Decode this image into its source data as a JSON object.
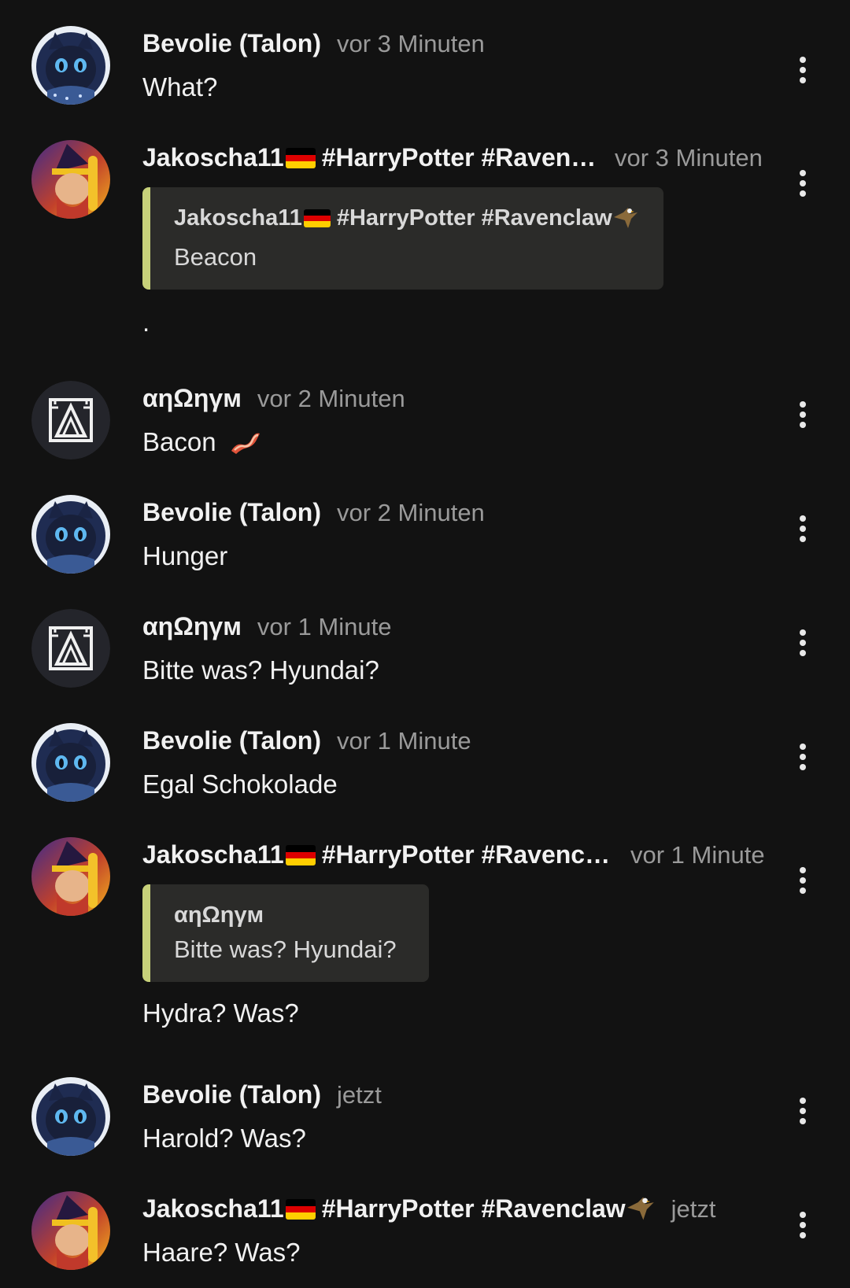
{
  "colors": {
    "background": "#121212",
    "time_text": "#9a9a9a",
    "quote_bar": "#c7d17a",
    "quote_bg": "#2b2b29"
  },
  "messages": [
    {
      "author": "Bevolie (Talon)",
      "time": "vor 3 Minuten",
      "text": "What?",
      "avatar": "blue-cat-avatar"
    },
    {
      "author_name": "Jakoscha11",
      "author_tags": "#HarryPotter #Ravencl…",
      "time": "vor 3 Minuten",
      "quote": {
        "author_name": "Jakoscha11",
        "author_tags": "#HarryPotter #Ravenclaw",
        "text": "Beacon"
      },
      "text": ".",
      "avatar": "wizard-avatar"
    },
    {
      "author": "αηΩηγм",
      "time": "vor 2 Minuten",
      "text": "Bacon",
      "emoji": "bacon-emoji",
      "avatar": "maze-logo-avatar"
    },
    {
      "author": "Bevolie (Talon)",
      "time": "vor 2 Minuten",
      "text": "Hunger",
      "avatar": "blue-cat-avatar"
    },
    {
      "author": "αηΩηγм",
      "time": "vor 1 Minute",
      "text": "Bitte was? Hyundai?",
      "avatar": "maze-logo-avatar"
    },
    {
      "author": "Bevolie (Talon)",
      "time": "vor 1 Minute",
      "text": "Egal Schokolade",
      "avatar": "blue-cat-avatar"
    },
    {
      "author_name": "Jakoscha11",
      "author_tags": "#HarryPotter #Ravencla…",
      "time": "vor 1 Minute",
      "quote": {
        "author": "αηΩηγм",
        "text": "Bitte was? Hyundai?"
      },
      "text": "Hydra? Was?",
      "avatar": "wizard-avatar"
    },
    {
      "author": "Bevolie (Talon)",
      "time": "jetzt",
      "text": "Harold? Was?",
      "avatar": "blue-cat-avatar"
    },
    {
      "author_name": "Jakoscha11",
      "author_tags": "#HarryPotter #Ravenclaw",
      "time": "jetzt",
      "text": "Haare? Was?",
      "avatar": "wizard-avatar"
    }
  ]
}
